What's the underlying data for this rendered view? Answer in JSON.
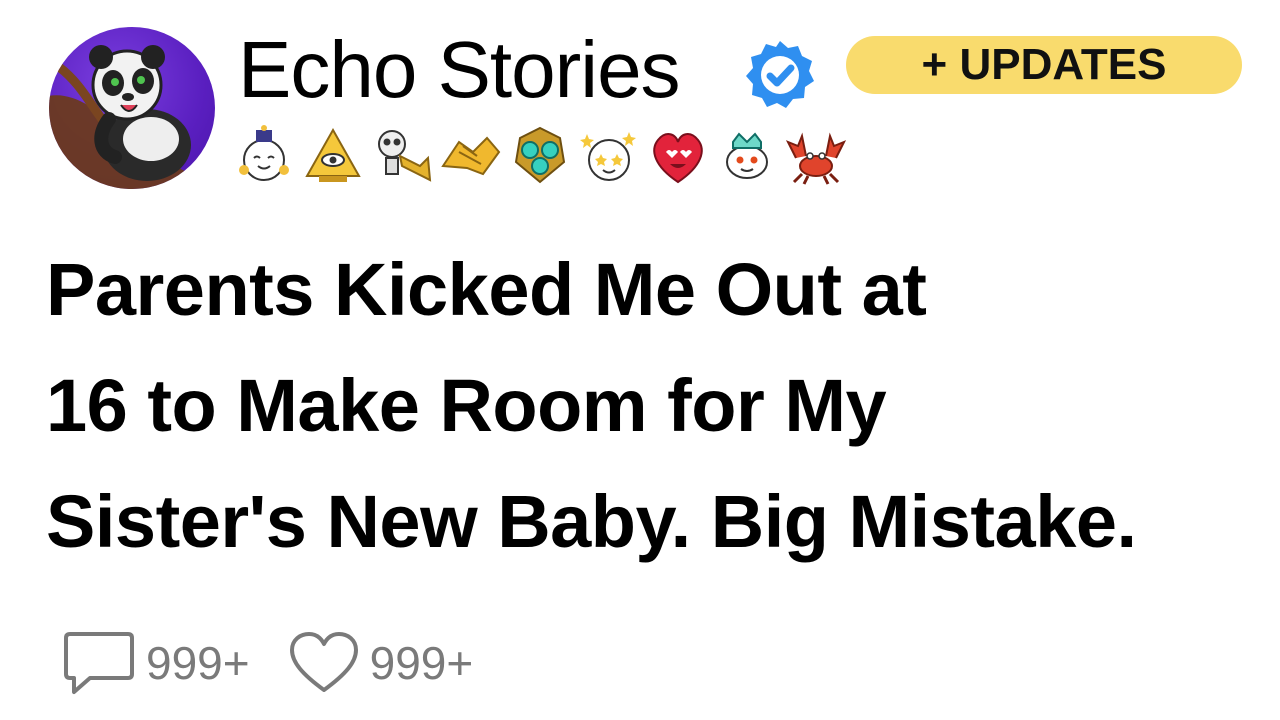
{
  "header": {
    "channel_name": "Echo Stories",
    "verified_icon": "verified-check-icon",
    "avatar_icon": "panda-avatar",
    "updates_label": "+ UPDATES",
    "updates_color": "#f9db6d",
    "verified_color": "#2f8ff0"
  },
  "awards": [
    {
      "icon": "wholesome-award-icon"
    },
    {
      "icon": "illuminati-award-icon"
    },
    {
      "icon": "skeleton-trumpet-award-icon"
    },
    {
      "icon": "handshake-award-icon"
    },
    {
      "icon": "gem-trophy-award-icon"
    },
    {
      "icon": "starstruck-award-icon"
    },
    {
      "icon": "heart-eyes-award-icon"
    },
    {
      "icon": "snoo-crown-award-icon"
    },
    {
      "icon": "crab-award-icon"
    }
  ],
  "post": {
    "title_lines": [
      "Parents Kicked Me Out at",
      "16 to Make Room for My",
      "Sister's New Baby. Big Mistake."
    ]
  },
  "footer": {
    "comments_icon": "comment-bubble-icon",
    "comments_count": "999+",
    "likes_icon": "heart-icon",
    "likes_count": "999+"
  }
}
